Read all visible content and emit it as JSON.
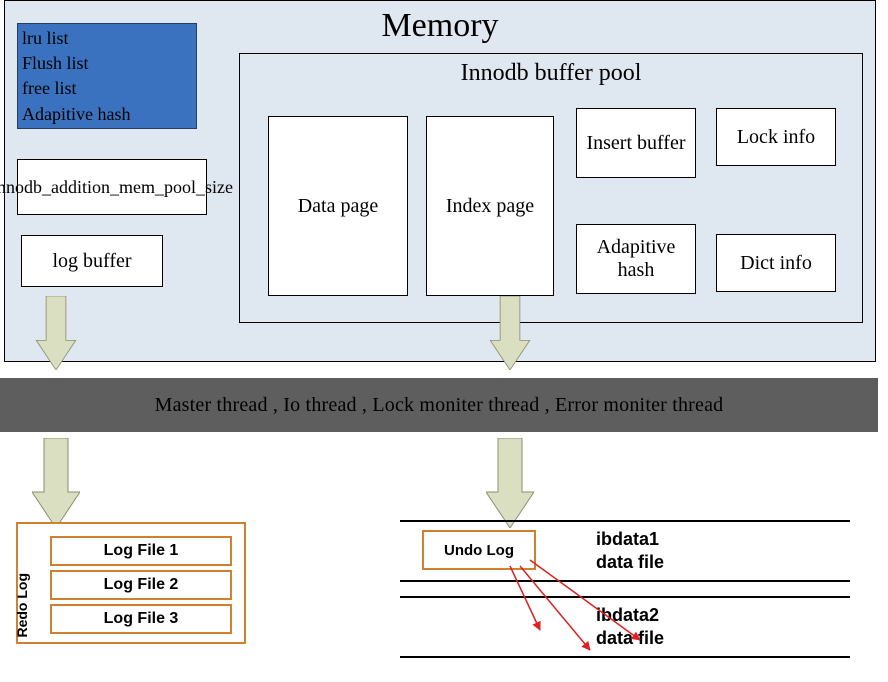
{
  "memory": {
    "title": "Memory",
    "lists_box": {
      "lru": "lru list",
      "flush": "Flush list",
      "free": "free list",
      "ah": "Adapitive hash"
    },
    "mem_pool": "Innodb_addition_mem_pool_size",
    "log_buffer": "log buffer",
    "buffer_pool": {
      "title": "Innodb buffer pool",
      "data_page": "Data page",
      "index_page": "Index page",
      "insert_buffer": "Insert buffer",
      "lock_info": "Lock info",
      "adaptive_hash": "Adapitive hash",
      "dict_info": "Dict info"
    }
  },
  "threads_text": "Master thread ,   Io thread  ,   Lock moniter thread   ,  Error moniter thread",
  "redo": {
    "label": "Redo Log",
    "files": [
      "Log File 1",
      "Log File 2",
      "Log File 3"
    ]
  },
  "ibdata": {
    "undo": "Undo Log",
    "file1_name": "ibdata1",
    "file1_sub": "data file",
    "file2_name": "ibdata2",
    "file2_sub": "data file"
  }
}
